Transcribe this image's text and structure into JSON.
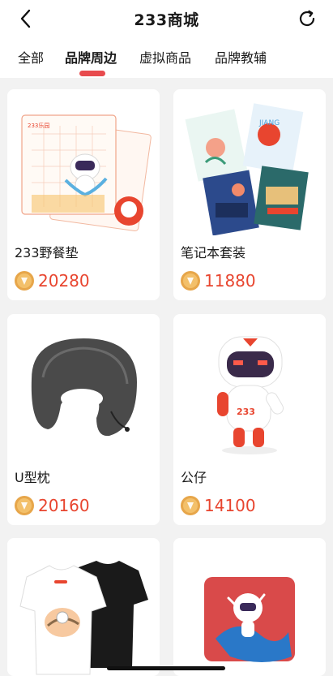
{
  "header": {
    "title": "233商城",
    "back_icon": "chevron-left-icon",
    "refresh_icon": "refresh-icon"
  },
  "tabs": [
    {
      "label": "全部",
      "active": false
    },
    {
      "label": "品牌周边",
      "active": true
    },
    {
      "label": "虚拟商品",
      "active": false
    },
    {
      "label": "品牌教辅",
      "active": false
    }
  ],
  "products": [
    {
      "name": "233野餐垫",
      "price": "20280",
      "image": "picnic-mat-image"
    },
    {
      "name": "笔记本套装",
      "price": "11880",
      "image": "notebook-set-image"
    },
    {
      "name": "U型枕",
      "price": "20160",
      "image": "u-pillow-image"
    },
    {
      "name": "公仔",
      "price": "14100",
      "image": "figure-doll-image"
    },
    {
      "name": "",
      "price": "",
      "image": "tshirt-image"
    },
    {
      "name": "",
      "price": "",
      "image": "pillow-cushion-image"
    }
  ],
  "colors": {
    "accent": "#e84b4e",
    "price": "#e8452f",
    "coin": "#e7a64a"
  }
}
